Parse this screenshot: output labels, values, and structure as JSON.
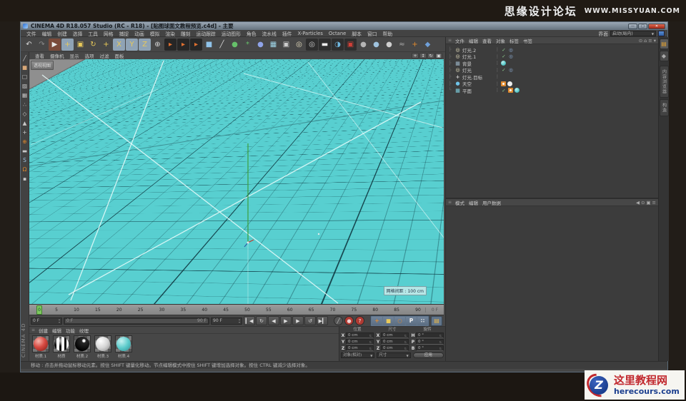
{
  "banner": {
    "site_name": "思缘设计论坛",
    "site_url": "WWW.MISSYUAN.COM"
  },
  "window": {
    "title": "CINEMA 4D R18.057 Studio (RC - R18) - [贴图球面文教程预览.c4d] - 主要",
    "minimize": "—",
    "maximize": "□",
    "close": "✕"
  },
  "menu_bar": {
    "items": [
      "文件",
      "编辑",
      "创建",
      "选择",
      "工具",
      "网格",
      "捕捉",
      "动画",
      "模拟",
      "渲染",
      "雕刻",
      "运动跟踪",
      "运动图形",
      "角色",
      "流水线",
      "插件",
      "X-Particles",
      "Octane",
      "脚本",
      "窗口",
      "帮助"
    ],
    "interface_label": "界面",
    "interface_value": "启动(局内)",
    "dropdown_arrow": "▼"
  },
  "toolbar": {
    "icons": [
      {
        "n": "undo-icon",
        "g": "↶",
        "c": "#d8d8d8"
      },
      {
        "n": "redo-icon",
        "g": "↷",
        "c": "#8a8a8a"
      },
      {
        "n": "live-selection-icon",
        "g": "▶",
        "c": "#e8e8e8",
        "b": "#7a4a3a"
      },
      {
        "n": "move-icon",
        "g": "+",
        "c": "#e8c95a",
        "b": "#8fa3b5"
      },
      {
        "n": "scale-icon",
        "g": "▣",
        "c": "#e8c95a"
      },
      {
        "n": "rotate-icon",
        "g": "↻",
        "c": "#e8c95a"
      },
      {
        "n": "last-tool-icon",
        "g": "+",
        "c": "#e8c95a"
      },
      {
        "n": "lock-x-icon",
        "g": "X",
        "c": "#e8c95a",
        "round": true,
        "b": "#8fa3b5"
      },
      {
        "n": "lock-y-icon",
        "g": "Y",
        "c": "#e8c95a",
        "round": true,
        "b": "#8fa3b5"
      },
      {
        "n": "lock-z-icon",
        "g": "Z",
        "c": "#e8c95a",
        "round": true,
        "b": "#8fa3b5"
      },
      {
        "n": "coord-system-icon",
        "g": "⊕",
        "c": "#d8d8d8"
      },
      {
        "n": "key-record-1-icon",
        "g": "▸",
        "c": "#e07030",
        "b": "#262626"
      },
      {
        "n": "key-record-2-icon",
        "g": "▸",
        "c": "#e07030",
        "b": "#262626"
      },
      {
        "n": "key-record-3-icon",
        "g": "▸",
        "c": "#e07030",
        "b": "#262626"
      },
      {
        "n": "add-cube-icon",
        "g": "■",
        "c": "#8fc3ea"
      },
      {
        "n": "pen-icon",
        "g": "╱",
        "c": "#d8d8d8"
      },
      {
        "n": "generator-icon",
        "g": "●",
        "c": "#66c06a"
      },
      {
        "n": "mograph-icon",
        "g": "*",
        "c": "#66c06a"
      },
      {
        "n": "deformer-icon",
        "g": "●",
        "c": "#8fa3e8"
      },
      {
        "n": "floor-icon",
        "g": "▦",
        "c": "#9fd6e8"
      },
      {
        "n": "camera-icon",
        "g": "▣",
        "c": "#cccccc"
      },
      {
        "n": "light-icon",
        "g": "◎",
        "c": "#e8e0c0"
      },
      {
        "n": "render-view-icon",
        "g": "◎",
        "c": "#cccccc",
        "b": "#2e2e2e"
      },
      {
        "n": "render-region-icon",
        "g": "▬",
        "c": "#eeeeee",
        "b": "#2e2e2e"
      },
      {
        "n": "render-editor-icon",
        "g": "◑",
        "c": "#6fb7e0",
        "b": "#2e2e2e"
      },
      {
        "n": "render-settings-icon",
        "g": "▣",
        "c": "#d04038",
        "b": "#2e2e2e"
      },
      {
        "n": "sphere-gray-icon",
        "g": "●",
        "c": "#b5b5b5"
      },
      {
        "n": "sphere-blue-icon",
        "g": "●",
        "c": "#9fc3de"
      },
      {
        "n": "sphere-light-icon",
        "g": "●",
        "c": "#cfcfcf"
      },
      {
        "n": "snap-tools-icon",
        "g": "≈",
        "c": "#aaaaaa"
      },
      {
        "n": "axis-modify-icon",
        "g": "+",
        "c": "#e08a2e"
      },
      {
        "n": "workplane-icon",
        "g": "◆",
        "c": "#6f9fd8"
      }
    ]
  },
  "left_toolbar": {
    "icons": [
      {
        "n": "freehand-icon",
        "g": "╱",
        "c": "#c8c8c8"
      },
      {
        "n": "make-editable-icon",
        "g": "■",
        "c": "#d8a878"
      },
      {
        "n": "model-mode-icon",
        "g": "□",
        "c": "#c8c8c8"
      },
      {
        "n": "texture-mode-icon",
        "g": "▨",
        "c": "#c8c8c8"
      },
      {
        "n": "workplane-mode-icon",
        "g": "▦",
        "c": "#c8c8c8"
      },
      {
        "n": "points-mode-icon",
        "g": "∴",
        "c": "#c8c8c8"
      },
      {
        "n": "edges-mode-icon",
        "g": "◇",
        "c": "#c8c8c8"
      },
      {
        "n": "polygons-mode-icon",
        "g": "▲",
        "c": "#c8c8c8"
      },
      {
        "n": "tweak-mode-icon",
        "g": "+",
        "c": "#c8c8c8"
      },
      {
        "n": "enable-axis-icon",
        "g": "⊕",
        "c": "#e08a2e"
      },
      {
        "n": "mouse-mode-icon",
        "g": "▬",
        "c": "#c8c8c8"
      },
      {
        "n": "soft-selection-icon",
        "g": "S",
        "c": "#9fc3de"
      },
      {
        "n": "magnet-icon",
        "g": "Ω",
        "c": "#e08a2e"
      },
      {
        "n": "lock-icon",
        "g": "▪",
        "c": "#c8c8c8"
      }
    ],
    "brand": "CINEMA 4D"
  },
  "viewport": {
    "menu": [
      "查看",
      "摄像机",
      "显示",
      "选项",
      "过滤",
      "面板"
    ],
    "label": "透视视图",
    "grid_label": "网格间距 : 100 cm",
    "nav_icons": [
      {
        "n": "pan-icon",
        "g": "+"
      },
      {
        "n": "dolly-icon",
        "g": "↕"
      },
      {
        "n": "orbit-icon",
        "g": "↻"
      },
      {
        "n": "toggle-view-icon",
        "g": "▣"
      }
    ]
  },
  "timeline": {
    "ticks": [
      "0",
      "5",
      "10",
      "15",
      "20",
      "25",
      "30",
      "35",
      "40",
      "45",
      "50",
      "55",
      "60",
      "65",
      "70",
      "75",
      "80",
      "85",
      "90"
    ],
    "end_label": "0 F",
    "playhead": "0",
    "current_frame": "0 F",
    "range_start": "0 F",
    "range_end": "90 F",
    "last_frame": "90 F"
  },
  "transport": {
    "buttons": [
      {
        "n": "goto-start-button",
        "g": "▎◀"
      },
      {
        "n": "loop-button",
        "g": "↻"
      },
      {
        "n": "prev-frame-button",
        "g": "◀"
      },
      {
        "n": "play-button",
        "g": "▶",
        "play": true
      },
      {
        "n": "next-frame-button",
        "g": "▶"
      },
      {
        "n": "cycle-button",
        "g": "↺"
      },
      {
        "n": "goto-end-button",
        "g": "▶▎"
      }
    ],
    "round_buttons": [
      {
        "n": "record-keyframe-button",
        "g": "╱",
        "c": "#cccccc",
        "b": "#555555"
      },
      {
        "n": "autokey-button",
        "g": "●",
        "c": "#f0d0d0",
        "b": "#b03a32"
      },
      {
        "n": "keyframe-selection-button",
        "g": "?",
        "c": "#ffffff",
        "b": "#b03a32"
      }
    ],
    "toggles": [
      {
        "n": "key-position-toggle",
        "g": "+",
        "c": "#e08a2e"
      },
      {
        "n": "key-scale-toggle",
        "g": "■",
        "c": "#e8c95a"
      },
      {
        "n": "key-rotation-toggle",
        "g": "○",
        "c": "#e08a2e"
      },
      {
        "n": "key-parameter-toggle",
        "g": "P",
        "c": "#f0f0f0"
      },
      {
        "n": "key-pla-toggle",
        "g": "∷",
        "c": "#e8e8e8"
      }
    ],
    "film_icon": "▤"
  },
  "materials": {
    "menu": [
      "创建",
      "编辑",
      "功能",
      "纹理"
    ],
    "items": [
      {
        "name": "材质.1",
        "type": "m-red"
      },
      {
        "name": "材质",
        "type": "m-stripe"
      },
      {
        "name": "材质.2",
        "type": "m-black"
      },
      {
        "name": "材质.3",
        "type": "m-white"
      },
      {
        "name": "材质.4",
        "type": "m-cyan"
      }
    ]
  },
  "coordinates": {
    "groups": [
      {
        "title": "位置",
        "rows": [
          {
            "label": "X",
            "value": "0 cm"
          },
          {
            "label": "Y",
            "value": "0 cm"
          },
          {
            "label": "Z",
            "value": "0 cm"
          }
        ]
      },
      {
        "title": "尺寸",
        "rows": [
          {
            "label": "X",
            "value": "0 cm"
          },
          {
            "label": "Y",
            "value": "0 cm"
          },
          {
            "label": "Z",
            "value": "0 cm"
          }
        ]
      },
      {
        "title": "旋转",
        "rows": [
          {
            "label": "H",
            "value": "0 °"
          },
          {
            "label": "P",
            "value": "0 °"
          },
          {
            "label": "B",
            "value": "0 °"
          }
        ]
      }
    ],
    "dropdown_object": "对象(相对)",
    "dropdown_size": "尺寸",
    "apply_label": "应用"
  },
  "status_bar": {
    "text": "移动 : 点击并拖动鼠标移动元素。按住 SHIFT 键量化移动。节点编辑模式中按住 SHIFT 键增加选择对象。按住 CTRL 键减少选择对象。"
  },
  "object_manager": {
    "menu": [
      "文件",
      "编辑",
      "查看",
      "对象",
      "标签",
      "书签"
    ],
    "right_icons": [
      {
        "n": "search-icon",
        "g": "⊙"
      },
      {
        "n": "home-icon",
        "g": "⌂"
      },
      {
        "n": "path-icon",
        "g": "≡"
      },
      {
        "n": "filter-icon",
        "g": "▾"
      }
    ],
    "objects": [
      {
        "t": "├",
        "name": "灯光.2",
        "icon": "oi-light",
        "check": true,
        "target": true
      },
      {
        "t": "├",
        "name": "灯光.1",
        "icon": "oi-light",
        "check": true,
        "target": true
      },
      {
        "t": "├",
        "name": "背景",
        "icon": "oi-bg",
        "texture": true
      },
      {
        "t": "├",
        "name": "灯光",
        "icon": "oi-light",
        "check": true,
        "target": true
      },
      {
        "t": "├",
        "name": "灯光.目标",
        "icon": "oi-null"
      },
      {
        "t": "├",
        "name": "天空",
        "icon": "oi-sky",
        "compositing": true,
        "extra": true
      },
      {
        "t": "└",
        "name": "平面",
        "icon": "oi-plane",
        "check": true,
        "compositing": true,
        "texture": true
      }
    ]
  },
  "attribute_manager": {
    "menu": [
      "模式",
      "编辑",
      "用户数据"
    ],
    "right_icons": [
      {
        "n": "back-icon",
        "g": "◀"
      },
      {
        "n": "search-icon",
        "g": "⊙"
      },
      {
        "n": "lock-icon",
        "g": "▣"
      },
      {
        "n": "settings-icon",
        "g": "≡"
      }
    ]
  },
  "right_tabs": {
    "icon_tabs": [
      {
        "n": "tab-attributes-icon",
        "g": "▤",
        "c": "#e0a030",
        "active": true
      },
      {
        "n": "tab-layer-icon",
        "g": "◆",
        "c": "#aaaaaa"
      }
    ],
    "text_tabs": [
      "内容浏览器",
      "构造"
    ]
  },
  "footer_logo": {
    "initial": "Z",
    "title": "这里教程网",
    "url": "herecours.com"
  },
  "colors": {
    "viewport_bg": "#58cfd0",
    "panel_bg": "#474747",
    "dark_bg": "#3c3c3c",
    "accent_orange": "#e08a2e",
    "titlebar": "#8b98a5",
    "close_red": "#c0392b",
    "site_red": "#c1272d",
    "site_blue": "#1c3f8f"
  }
}
